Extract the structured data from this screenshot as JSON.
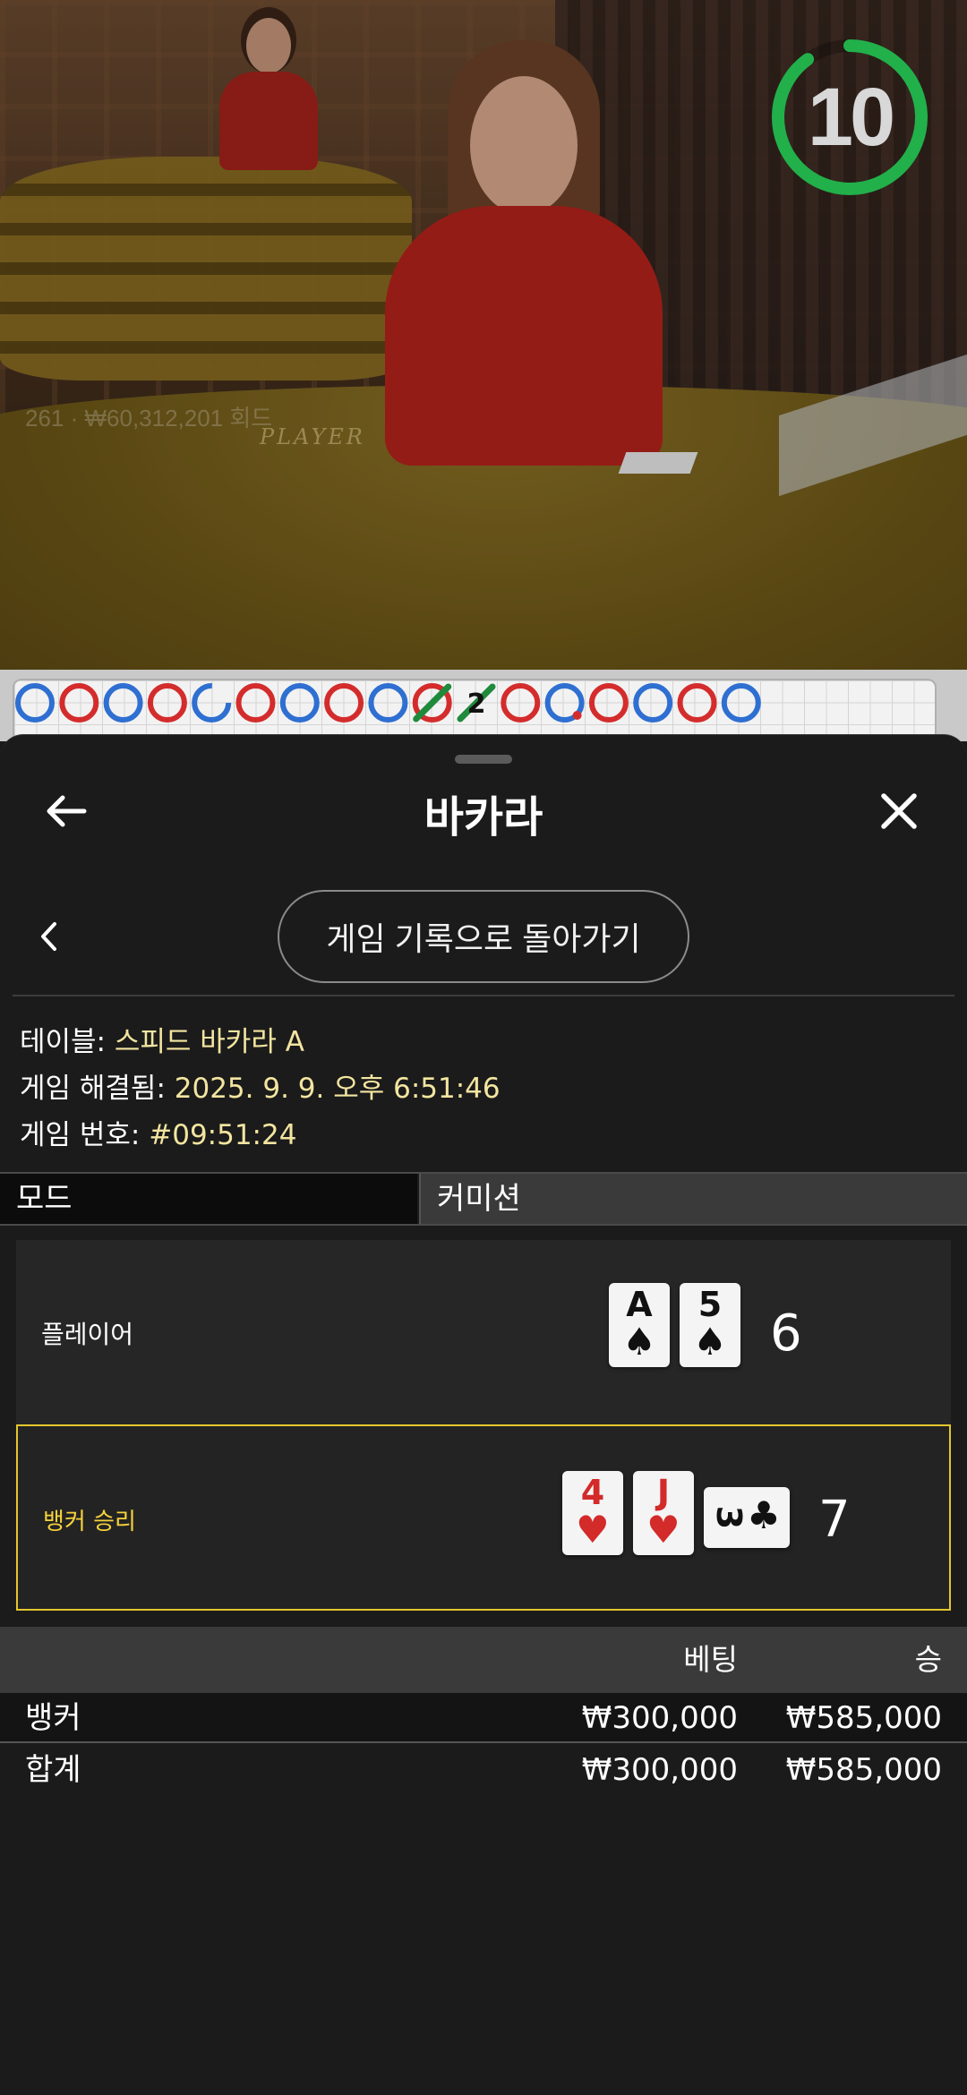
{
  "video": {
    "round_info": "261 · ₩60,312,201 회드",
    "table_text": "PLAYER",
    "countdown": "10",
    "countdown_fraction": 0.9
  },
  "roadmap": {
    "beads": [
      "blue",
      "red",
      "blue",
      "red",
      "blue-open",
      "red",
      "blue",
      "red",
      "blue",
      "red-slash",
      "green-slash-2",
      "red",
      "blue-dot",
      "red",
      "blue",
      "red",
      "blue"
    ],
    "tie_count": "2"
  },
  "sheet": {
    "title": "바카라",
    "history_button": "게임 기록으로 돌아가기",
    "table_label": "테이블:",
    "table_value": "스피드 바카라 A",
    "resolved_label": "게임 해결됨:",
    "resolved_value": "2025. 9. 9. 오후 6:51:46",
    "game_no_label": "게임 번호:",
    "game_no_value": "#09:51:24",
    "mode": "모드",
    "commission": "커미션"
  },
  "hands": {
    "player": {
      "label": "플레이어",
      "score": "6",
      "cards": [
        {
          "rank": "A",
          "suit": "♠",
          "color": "black"
        },
        {
          "rank": "5",
          "suit": "♠",
          "color": "black"
        }
      ]
    },
    "banker": {
      "label": "뱅커 승리",
      "score": "7",
      "cards": [
        {
          "rank": "4",
          "suit": "♥",
          "color": "red"
        },
        {
          "rank": "J",
          "suit": "♥",
          "color": "red"
        },
        {
          "rank": "3",
          "suit": "♣",
          "color": "black",
          "sideways": true
        }
      ]
    }
  },
  "bets": {
    "headers": {
      "bet": "베팅",
      "win": "승"
    },
    "rows": [
      {
        "name": "뱅커",
        "bet": "₩300,000",
        "win": "₩585,000"
      },
      {
        "name": "합계",
        "bet": "₩300,000",
        "win": "₩585,000"
      }
    ]
  },
  "colors": {
    "timer_green": "#22b04b",
    "banker_highlight": "#e4c62e",
    "bead_blue": "#2e6fd1",
    "bead_red": "#d42c2c"
  }
}
